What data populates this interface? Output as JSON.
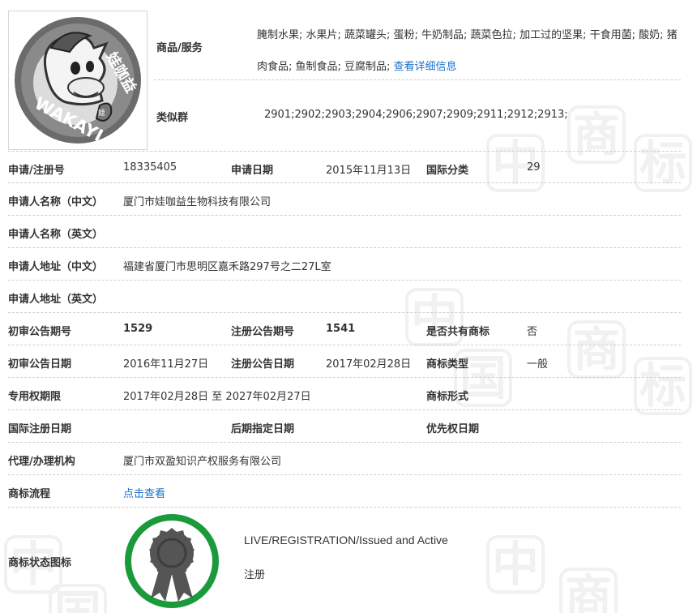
{
  "watermark_chars": [
    "中",
    "国",
    "商",
    "标"
  ],
  "logo": {
    "brand_cn": "娃咖益",
    "brand_en": "WAKAYI",
    "heart_text": "娃"
  },
  "goods": {
    "label": "商品/服务",
    "text": "腌制水果; 水果片; 蔬菜罐头; 蛋粉; 牛奶制品; 蔬菜色拉; 加工过的坚果; 干食用菌; 酸奶; 猪肉食品; 鱼制食品; 豆腐制品;",
    "more_link": "查看详细信息"
  },
  "similar_group": {
    "label": "类似群",
    "value": "2901;2902;2903;2904;2906;2907;2909;2911;2912;2913;"
  },
  "reg_no": {
    "label": "申请/注册号",
    "value": "18335405"
  },
  "apply_date": {
    "label": "申请日期",
    "value": "2015年11月13日"
  },
  "intl_class": {
    "label": "国际分类",
    "value": "29"
  },
  "applicant_cn": {
    "label": "申请人名称（中文）",
    "value": "厦门市娃咖益生物科技有限公司"
  },
  "applicant_en": {
    "label": "申请人名称（英文）",
    "value": ""
  },
  "address_cn": {
    "label": "申请人地址（中文）",
    "value": "福建省厦门市思明区嘉禾路297号之二27L室"
  },
  "address_en": {
    "label": "申请人地址（英文）",
    "value": ""
  },
  "prelim_pub_no": {
    "label": "初审公告期号",
    "value": "1529"
  },
  "reg_pub_no": {
    "label": "注册公告期号",
    "value": "1541"
  },
  "shared": {
    "label": "是否共有商标",
    "value": "否"
  },
  "prelim_pub_date": {
    "label": "初审公告日期",
    "value": "2016年11月27日"
  },
  "reg_pub_date": {
    "label": "注册公告日期",
    "value": "2017年02月28日"
  },
  "mark_type": {
    "label": "商标类型",
    "value": "一般"
  },
  "exclusive_period": {
    "label": "专用权期限",
    "value": "2017年02月28日 至 2027年02月27日"
  },
  "mark_form": {
    "label": "商标形式",
    "value": ""
  },
  "intl_reg_date": {
    "label": "国际注册日期",
    "value": ""
  },
  "later_designation": {
    "label": "后期指定日期",
    "value": ""
  },
  "priority_date": {
    "label": "优先权日期",
    "value": ""
  },
  "agent": {
    "label": "代理/办理机构",
    "value": "厦门市双盈知识产权服务有限公司"
  },
  "process": {
    "label": "商标流程",
    "link": "点击查看"
  },
  "status": {
    "label": "商标状态图标",
    "status_en": "LIVE/REGISTRATION/Issued and Active",
    "status_cn": "注册",
    "ring_color": "#1a9a3a",
    "medal_color": "#555555"
  }
}
